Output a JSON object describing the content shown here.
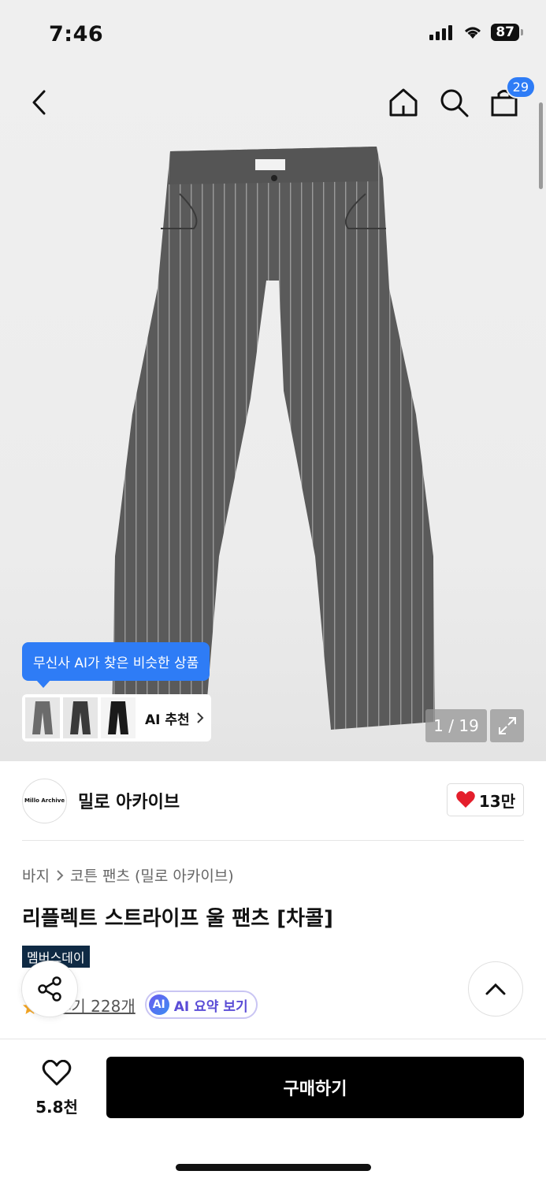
{
  "status": {
    "time": "7:46",
    "battery": "87"
  },
  "nav": {
    "cart_count": "29"
  },
  "gallery": {
    "counter": "1 / 19",
    "ai_tooltip": "무신사 AI가 찾은 비슷한 상품",
    "ai_rec_label": "AI 추천"
  },
  "brand": {
    "logo_text": "Millo Archive",
    "name": "밀로 아카이브",
    "likes": "13만"
  },
  "breadcrumb": {
    "category": "바지",
    "subcategory": "코튼 팬츠 (밀로 아카이브)"
  },
  "product": {
    "title": "리플렉트 스트라이프 울 팬츠 [차콜]",
    "badge": "멤버스데이",
    "review_link": "후기 228개",
    "ai_icon_text": "AI",
    "ai_summary": "AI 요약 보기"
  },
  "bottom": {
    "wish_count": "5.8천",
    "buy_label": "구매하기"
  },
  "colors": {
    "accent": "#2e7cf6",
    "badge_bg": "#0f2a44",
    "heart": "#e41e2b"
  }
}
